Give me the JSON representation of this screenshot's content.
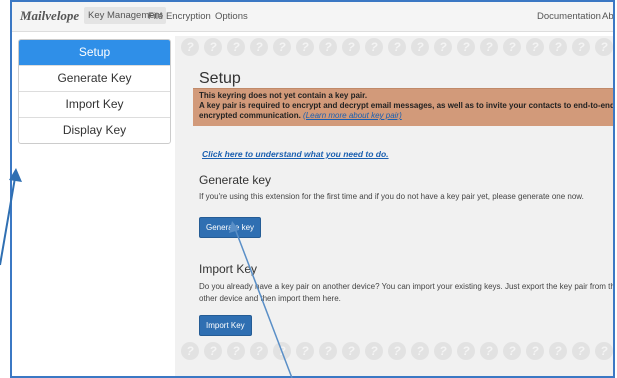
{
  "topbar": {
    "logo": "Mailvelope",
    "nav": [
      "Key Management",
      "File Encryption",
      "Options"
    ],
    "right": [
      "Documentation",
      "Ab"
    ]
  },
  "sidebar": {
    "items": [
      "Setup",
      "Generate Key",
      "Import Key",
      "Display Key"
    ]
  },
  "main": {
    "title": "Setup",
    "alert_line1": "This keyring does not yet contain a key pair.",
    "alert_line2": "A key pair is required to encrypt and decrypt email messages, as well as to invite your contacts to end-to-end encrypted communication.",
    "alert_link": "(Learn more about key pair)",
    "understand_link": "Click here to understand what you need to do.",
    "generate_heading": "Generate key",
    "generate_text": "If you're using this extension for the first time and if you do not have a key pair yet, please generate one now.",
    "generate_button": "Generate key",
    "import_heading": "Import Key",
    "import_text": "Do you already have a key pair on another device? You can import your existing keys. Just export the key pair from the other device and then import them here.",
    "import_button": "Import Key"
  },
  "colors": {
    "accent": "#2f8fe8",
    "alert_bg": "#d29a7a",
    "frame": "#3b78c4"
  }
}
